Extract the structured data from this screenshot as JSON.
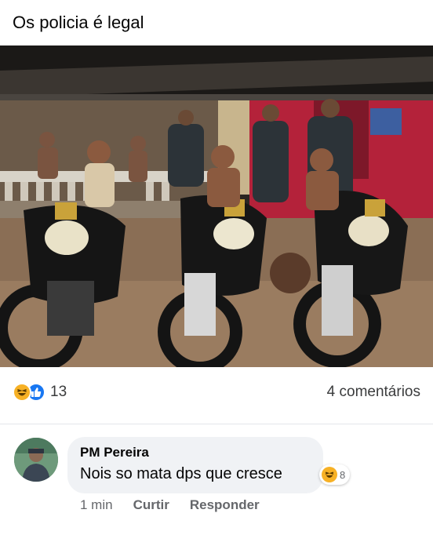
{
  "post": {
    "text": "Os policia é legal"
  },
  "reactions": {
    "icons": [
      "haha-icon",
      "like-icon"
    ],
    "count": "13"
  },
  "comments_summary": {
    "label": "4 comentários"
  },
  "comment": {
    "author": "PM Pereira",
    "text": "Nois so mata dps que cresce",
    "reaction_count": "8",
    "time": "1 min",
    "like_label": "Curtir",
    "reply_label": "Responder"
  },
  "colors": {
    "like_blue": "#1877f2",
    "haha_yellow": "#f7b125",
    "bubble_gray": "#f0f2f5",
    "secondary_text": "#65676b"
  }
}
